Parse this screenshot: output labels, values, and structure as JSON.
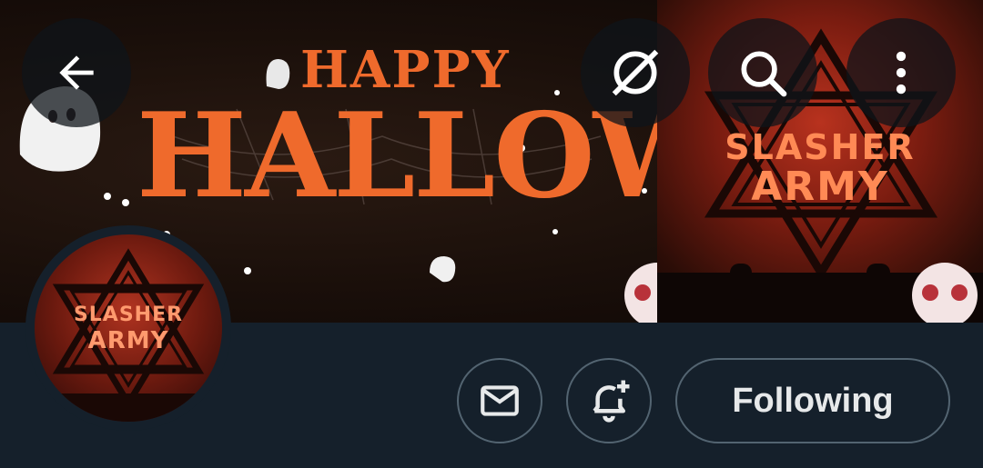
{
  "banner": {
    "headline_top": "HAPPY",
    "headline_main": "HALLOWEEN",
    "logo_line1": "SLASHER",
    "logo_line2": "ARMY"
  },
  "avatar": {
    "logo_line1": "SLASHER",
    "logo_line2": "ARMY"
  },
  "actions": {
    "follow_label": "Following"
  },
  "icons": [
    "back-arrow-icon",
    "grok-icon",
    "search-icon",
    "more-vertical-icon",
    "mail-icon",
    "bell-plus-icon"
  ],
  "colors": {
    "background": "#15202b",
    "banner_orange": "#ef6a2c",
    "border": "#536471",
    "text": "#e7e9ea"
  }
}
